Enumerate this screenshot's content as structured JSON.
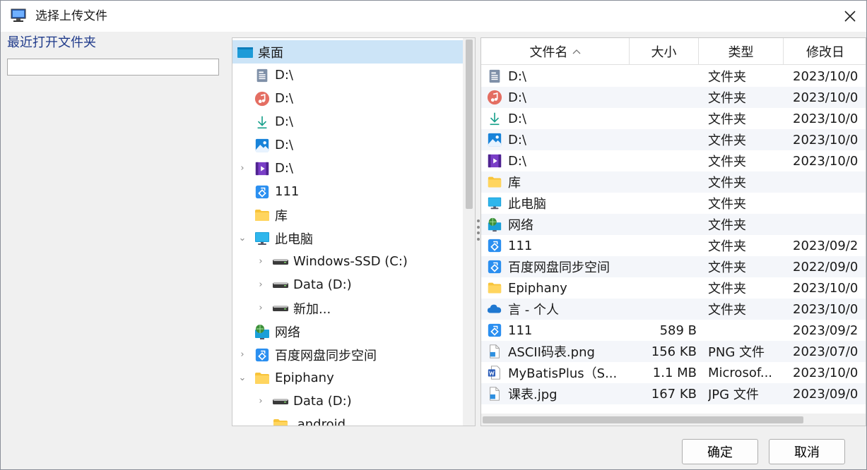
{
  "window": {
    "title": "选择上传文件"
  },
  "recent": {
    "label": "最近打开文件夹",
    "value": ""
  },
  "tree": {
    "items": [
      {
        "label": "桌面",
        "icon": "desktop-icon",
        "indent": 0,
        "chevron": "",
        "selected": true
      },
      {
        "label": "D:\\",
        "icon": "document-icon",
        "indent": 1,
        "chevron": ""
      },
      {
        "label": "D:\\",
        "icon": "music-icon",
        "indent": 1,
        "chevron": ""
      },
      {
        "label": "D:\\",
        "icon": "download-icon",
        "indent": 1,
        "chevron": ""
      },
      {
        "label": "D:\\",
        "icon": "picture-icon",
        "indent": 1,
        "chevron": ""
      },
      {
        "label": "D:\\",
        "icon": "video-icon",
        "indent": 1,
        "chevron": "›"
      },
      {
        "label": "111",
        "icon": "baidu-sync-icon",
        "indent": 1,
        "chevron": ""
      },
      {
        "label": "库",
        "icon": "folder-icon",
        "indent": 1,
        "chevron": ""
      },
      {
        "label": "此电脑",
        "icon": "computer-icon",
        "indent": 1,
        "chevron": "⌄"
      },
      {
        "label": "Windows-SSD (C:)",
        "icon": "drive-icon",
        "indent": 2,
        "chevron": "›"
      },
      {
        "label": "Data (D:)",
        "icon": "drive-icon",
        "indent": 2,
        "chevron": "›"
      },
      {
        "label": "新加...",
        "icon": "drive-icon",
        "indent": 2,
        "chevron": "›"
      },
      {
        "label": "网络",
        "icon": "network-icon",
        "indent": 1,
        "chevron": ""
      },
      {
        "label": "百度网盘同步空间",
        "icon": "baidu-sync-icon",
        "indent": 1,
        "chevron": "›"
      },
      {
        "label": "Epiphany",
        "icon": "folder-icon",
        "indent": 1,
        "chevron": "⌄"
      },
      {
        "label": "Data (D:)",
        "icon": "drive-icon",
        "indent": 2,
        "chevron": "›"
      },
      {
        "label": ".android",
        "icon": "folder-icon",
        "indent": 2,
        "chevron": ""
      }
    ]
  },
  "list": {
    "columns": {
      "name": "文件名",
      "size": "大小",
      "type": "类型",
      "date": "修改日"
    },
    "rows": [
      {
        "name": "D:\\",
        "icon": "document-icon",
        "size": "",
        "type": "文件夹",
        "date": "2023/10/0"
      },
      {
        "name": "D:\\",
        "icon": "music-icon",
        "size": "",
        "type": "文件夹",
        "date": "2023/10/0"
      },
      {
        "name": "D:\\",
        "icon": "download-icon",
        "size": "",
        "type": "文件夹",
        "date": "2023/10/0"
      },
      {
        "name": "D:\\",
        "icon": "picture-icon",
        "size": "",
        "type": "文件夹",
        "date": "2023/10/0"
      },
      {
        "name": "D:\\",
        "icon": "video-icon",
        "size": "",
        "type": "文件夹",
        "date": "2023/10/0"
      },
      {
        "name": "库",
        "icon": "folder-icon",
        "size": "",
        "type": "文件夹",
        "date": ""
      },
      {
        "name": "此电脑",
        "icon": "computer-icon",
        "size": "",
        "type": "文件夹",
        "date": ""
      },
      {
        "name": "网络",
        "icon": "network-icon",
        "size": "",
        "type": "文件夹",
        "date": ""
      },
      {
        "name": "111",
        "icon": "baidu-sync-icon",
        "size": "",
        "type": "文件夹",
        "date": "2023/09/2"
      },
      {
        "name": "百度网盘同步空间",
        "icon": "baidu-sync-icon",
        "size": "",
        "type": "文件夹",
        "date": "2022/09/0"
      },
      {
        "name": "Epiphany",
        "icon": "folder-icon",
        "size": "",
        "type": "文件夹",
        "date": "2023/10/0"
      },
      {
        "name": "言 - 个人",
        "icon": "onedrive-icon",
        "size": "",
        "type": "文件夹",
        "date": "2023/10/0"
      },
      {
        "name": "111",
        "icon": "baidu-sync-icon",
        "size": "589 B",
        "type": "",
        "date": "2023/09/2"
      },
      {
        "name": "ASCII码表.png",
        "icon": "image-file-icon",
        "size": "156 KB",
        "type": "PNG 文件",
        "date": "2023/07/0"
      },
      {
        "name": "MyBatisPlus（S...",
        "icon": "word-file-icon",
        "size": "1.1 MB",
        "type": "Microsof...",
        "date": "2023/10/0"
      },
      {
        "name": "课表.jpg",
        "icon": "image-file-icon",
        "size": "167 KB",
        "type": "JPG 文件",
        "date": "2023/09/0"
      }
    ]
  },
  "buttons": {
    "ok": "确定",
    "cancel": "取消"
  }
}
